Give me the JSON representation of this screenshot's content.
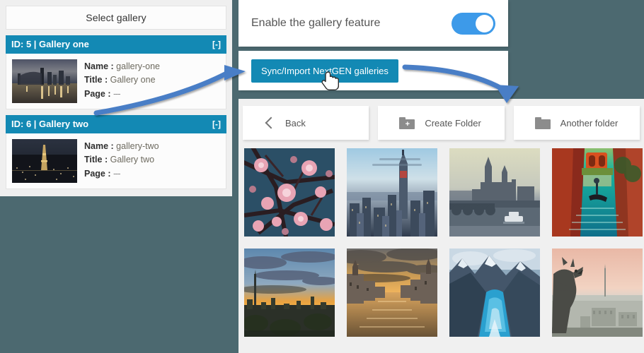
{
  "theme": {
    "page_background": "#4c6970",
    "panel_background": "#efefef",
    "accent_blue": "#1389b4",
    "toggle_blue": "#3d9ae9",
    "arrow_blue": "#4a7ec6"
  },
  "left_panel": {
    "header": "Select gallery",
    "galleries": [
      {
        "title": "ID: 5 | Gallery one",
        "collapse": "[-]",
        "fields": [
          {
            "key": "Name :",
            "value": "gallery-one"
          },
          {
            "key": "Title :",
            "value": "Gallery one"
          },
          {
            "key": "Page :",
            "value": "---"
          }
        ],
        "thumb_alt": "brooklyn-bridge-night"
      },
      {
        "title": "ID: 6 | Gallery two",
        "collapse": "[-]",
        "fields": [
          {
            "key": "Name :",
            "value": "gallery-two"
          },
          {
            "key": "Title :",
            "value": "Gallery two"
          },
          {
            "key": "Page :",
            "value": "---"
          }
        ],
        "thumb_alt": "eiffel-tower-night"
      }
    ]
  },
  "settings": {
    "enable_label": "Enable the gallery feature",
    "toggle_state": "on",
    "sync_button": "Sync/Import NextGEN galleries"
  },
  "folder_bar": {
    "buttons": [
      {
        "label": "Back",
        "icon": "chevron-left-icon"
      },
      {
        "label": "Create Folder",
        "icon": "folder-plus-icon"
      },
      {
        "label": "Another folder",
        "icon": "folder-icon"
      }
    ]
  },
  "gallery_grid": {
    "images": [
      {
        "name": "cherry-blossom",
        "alt": "Pink cherry blossoms on dark branches"
      },
      {
        "name": "new-york-skyline",
        "alt": "New York skyline with Empire State Building"
      },
      {
        "name": "london-parliament",
        "alt": "Houses of Parliament and the Thames"
      },
      {
        "name": "venice-canal",
        "alt": "Gondola on a Venice canal"
      },
      {
        "name": "city-sunset-park",
        "alt": "Golden sunset over a park and city"
      },
      {
        "name": "canal-sunset",
        "alt": "Canal at sunset with buildings"
      },
      {
        "name": "mountain-lake",
        "alt": "Snowy mountains above a blue lake"
      },
      {
        "name": "paris-gargoyle",
        "alt": "Gargoyle overlooking Paris"
      }
    ]
  },
  "annotations": {
    "arrow_one": "arrow from gallery list to sync button",
    "arrow_two": "arrow from sync button to folder area",
    "cursor": "pointing-hand-cursor"
  }
}
